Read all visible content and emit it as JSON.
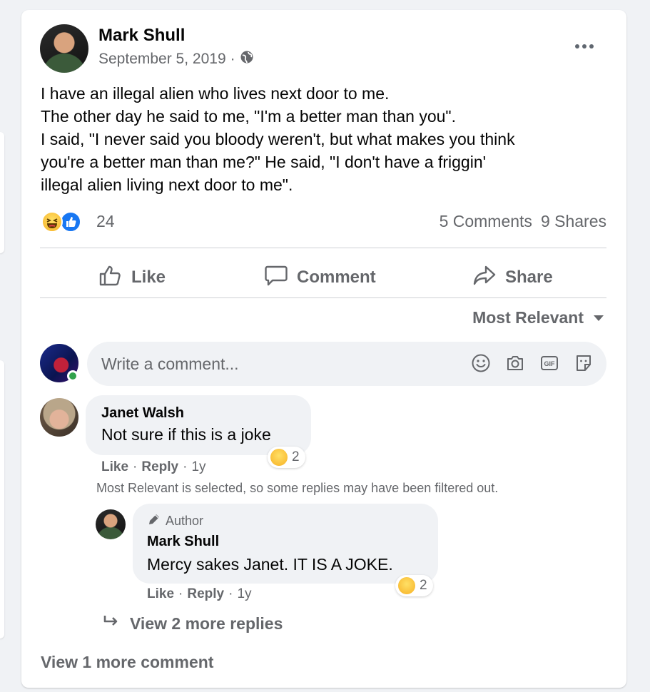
{
  "post": {
    "author": "Mark Shull",
    "date": "September 5, 2019",
    "separator": "·",
    "privacy_icon": "globe-icon",
    "text_lines": [
      "I have an illegal alien who lives next door to me.",
      "The other day he said to me, \"I'm a better man than you\".",
      "I said, \"I never said you bloody weren't, but what makes you think",
      "you're a better man than me?\" He said, \"I don't have a friggin'",
      "illegal alien living next door to me\"."
    ],
    "reaction_icons": [
      "haha-icon",
      "like-reaction-icon"
    ],
    "reaction_count": "24",
    "comments_count": "5 Comments",
    "shares_count": "9 Shares"
  },
  "actions": {
    "like": "Like",
    "comment": "Comment",
    "share": "Share"
  },
  "sort": {
    "label": "Most Relevant"
  },
  "composer": {
    "placeholder": "Write a comment...",
    "icons": [
      "emoji-icon",
      "camera-icon",
      "gif-icon",
      "sticker-icon"
    ]
  },
  "comments": [
    {
      "name": "Janet Walsh",
      "text": "Not sure if this is a joke",
      "reaction_count": "2",
      "like": "Like",
      "reply": "Reply",
      "age": "1y"
    }
  ],
  "filter_note": "Most Relevant is selected, so some replies may have been filtered out.",
  "reply": {
    "badge": "Author",
    "name": "Mark Shull",
    "text": "Mercy sakes Janet. IT IS A JOKE.",
    "reaction_count": "2",
    "like": "Like",
    "reply": "Reply",
    "age": "1y"
  },
  "view_replies": "View 2 more replies",
  "view_more_comments": "View 1 more comment",
  "colors": {
    "secondary_text": "#65676b",
    "bubble_bg": "#f0f2f5",
    "like_blue": "#1877f2",
    "haha_yellow": "#f7b125"
  }
}
